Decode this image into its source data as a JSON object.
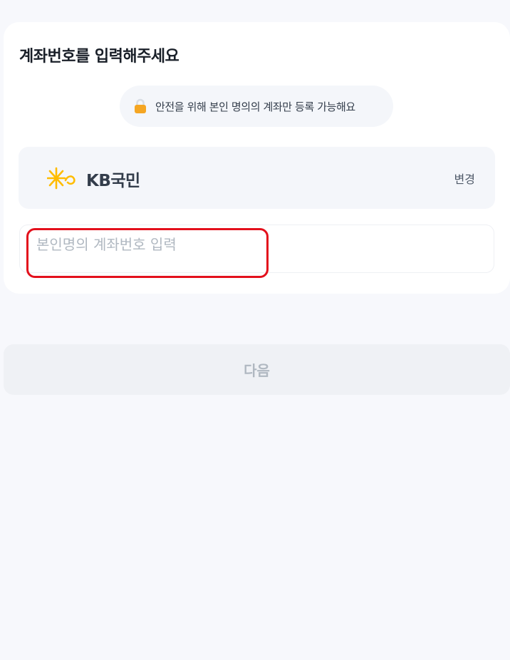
{
  "page": {
    "title": "계좌번호를 입력해주세요"
  },
  "notice": {
    "icon": "lock-icon",
    "icon_color": "#F5A623",
    "text": "안전을 위해 본인 명의의 계좌만 등록 가능해요"
  },
  "bank": {
    "logo_icon": "kb-star-logo",
    "logo_color": "#FFBC00",
    "name": "KB국민",
    "change_label": "변경"
  },
  "account_input": {
    "value": "",
    "placeholder": "본인명의 계좌번호 입력"
  },
  "highlight": {
    "color": "#E3101C"
  },
  "footer": {
    "next_label": "다음",
    "next_enabled": false
  }
}
